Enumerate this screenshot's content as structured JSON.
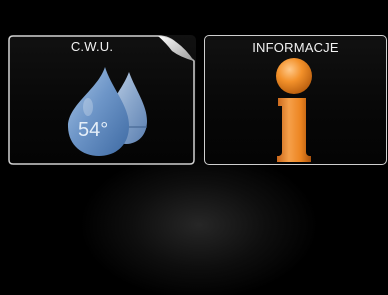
{
  "tiles": {
    "hot_water": {
      "title": "C.W.U.",
      "temperature": "54°",
      "icon": "water-drops-icon",
      "color": "#6f97c9"
    },
    "information": {
      "title": "INFORMACJE",
      "icon": "info-icon",
      "color": "#f08a1e"
    }
  }
}
